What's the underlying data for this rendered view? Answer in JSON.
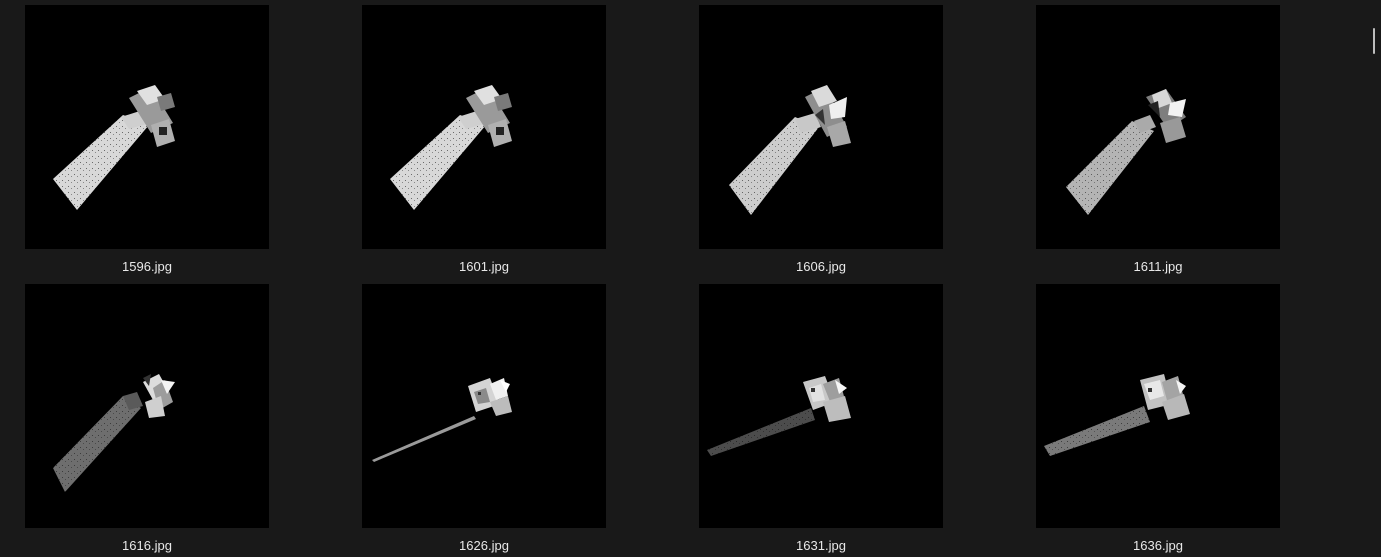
{
  "files": [
    {
      "name": "1596.jpg",
      "brightness": 0.9
    },
    {
      "name": "1601.jpg",
      "brightness": 0.9
    },
    {
      "name": "1606.jpg",
      "brightness": 0.85
    },
    {
      "name": "1611.jpg",
      "brightness": 0.75
    },
    {
      "name": "1616.jpg",
      "brightness": 0.45
    },
    {
      "name": "1626.jpg",
      "brightness": 0.55
    },
    {
      "name": "1631.jpg",
      "brightness": 0.35
    },
    {
      "name": "1636.jpg",
      "brightness": 0.5
    }
  ],
  "colors": {
    "background": "#191919",
    "thumbnail": "#000000",
    "caption": "#e8e8e8",
    "scrollbar": "#bdbdbd"
  }
}
